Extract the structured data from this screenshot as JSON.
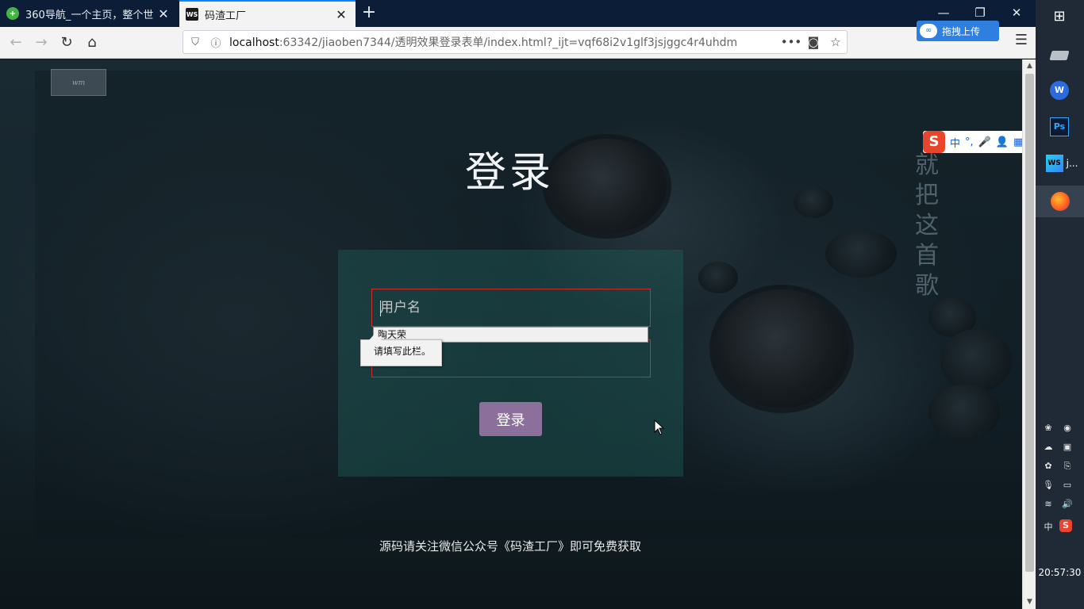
{
  "browser": {
    "tabs": [
      {
        "title": "360导航_一个主页，整个世界",
        "favicon": "360-icon",
        "active": false
      },
      {
        "title": "码渣工厂",
        "favicon": "webstorm-icon",
        "active": true
      }
    ],
    "new_tab_symbol": "+",
    "window_controls": {
      "minimize": "—",
      "restore": "❐",
      "close": "✕"
    },
    "url_host": "localhost",
    "url_path": ":63342/jiaoben7344/透明效果登录表单/index.html?_ijt=vqf68i2v1glf3jsjggc4r4uhdm",
    "page_actions": "•••",
    "upload_button_label": "拖拽上传"
  },
  "page": {
    "logo_text": "wm",
    "title": "登录",
    "username_placeholder": "用户名",
    "autocomplete_suggestion": "陶天荣",
    "validation_tooltip": "请填写此栏。",
    "login_button": "登录",
    "footer_text": "源码请关注微信公众号《码渣工厂》即可免费获取",
    "lyric_text": "就把这首歌"
  },
  "ime": {
    "logo": "S",
    "mode": "中",
    "punct": "°,"
  },
  "taskbar": {
    "webstorm_label": "j...",
    "tray_lang": "中",
    "clock": "20:57:30"
  },
  "colors": {
    "tab_bar": "#0c1d38",
    "login_box": "#1e5f5a",
    "input_border": "#d02b2b",
    "login_button": "#8c6f9b",
    "taskbar": "#1f2a36"
  }
}
